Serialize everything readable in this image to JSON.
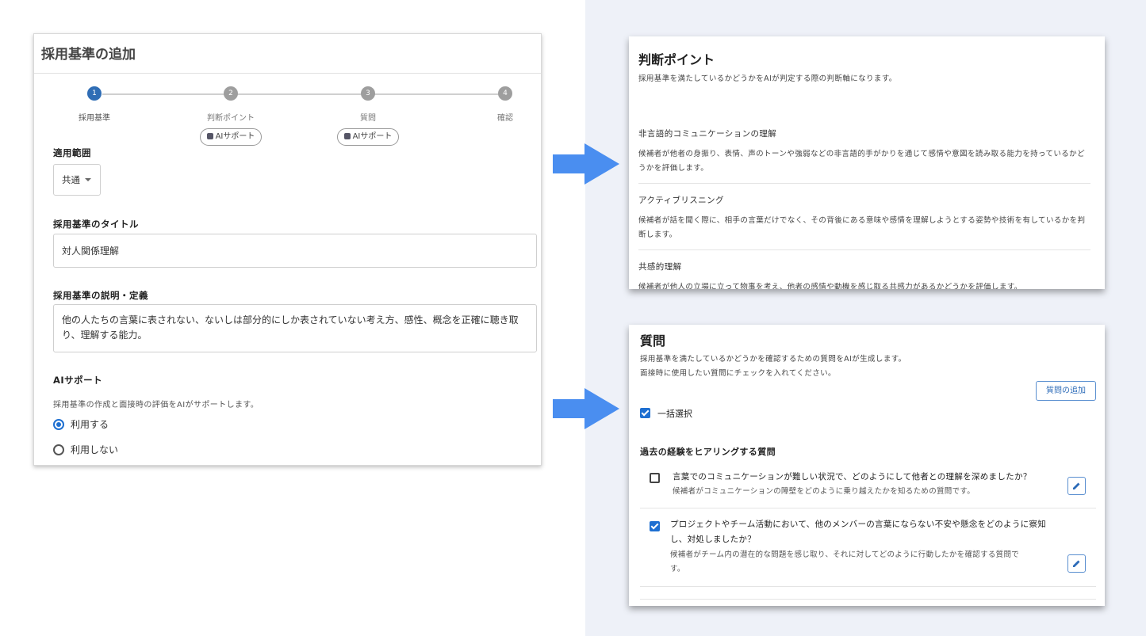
{
  "left_card": {
    "title": "採用基準の追加",
    "steps": [
      {
        "num": "1",
        "label": "採用基準"
      },
      {
        "num": "2",
        "label": "判断ポイント"
      },
      {
        "num": "3",
        "label": "質問"
      },
      {
        "num": "4",
        "label": "確認"
      }
    ],
    "ai_chip_label": "AIサポート",
    "scope": {
      "label": "適用範囲",
      "value": "共通"
    },
    "title_field": {
      "label": "採用基準のタイトル",
      "value": "対人関係理解"
    },
    "description_field": {
      "label": "採用基準の説明・定義",
      "value": "他の人たちの言葉に表されない、ないしは部分的にしか表されていない考え方、感性、概念を正確に聴き取り、理解する能力。"
    },
    "ai_support": {
      "label": "AIサポート",
      "description": "採用基準の作成と面接時の評価をAIがサポートします。",
      "options": [
        "利用する",
        "利用しない"
      ],
      "selected": "利用する"
    }
  },
  "judgment_card": {
    "title": "判断ポイント",
    "subtitle": "採用基準を満たしているかどうかをAIが判定する際の判断軸になります。",
    "items": [
      {
        "title": "非言語的コミュニケーションの理解",
        "description": "候補者が他者の身振り、表情、声のトーンや強弱などの非言語的手がかりを通じて感情や意図を読み取る能力を持っているかどうかを評価します。"
      },
      {
        "title": "アクティブリスニング",
        "description": "候補者が話を聞く際に、相手の言葉だけでなく、その背後にある意味や感情を理解しようとする姿勢や技術を有しているかを判断します。"
      },
      {
        "title": "共感的理解",
        "description": "候補者が他人の立場に立って物事を考え、他者の感情や動機を感じ取る共感力があるかどうかを評価します。"
      }
    ]
  },
  "questions_card": {
    "title": "質問",
    "subtitle_1": "採用基準を満たしているかどうかを確認するための質問をAIが生成します。",
    "subtitle_2": "面接時に使用したい質問にチェックを入れてください。",
    "add_button": "質問の追加",
    "select_all": "一括選択",
    "section_title": "過去の経験をヒアリングする質問",
    "questions": [
      {
        "checked": false,
        "text": "言葉でのコミュニケーションが難しい状況で、どのようにして他者との理解を深めましたか？",
        "note": "候補者がコミュニケーションの障壁をどのように乗り越えたかを知るための質問です。"
      },
      {
        "checked": true,
        "text_line1": "プロジェクトやチーム活動において、他のメンバーの言葉にならない不安や懸念をどのように察知",
        "text_line2": "し、対処しましたか？",
        "note_line1": "候補者がチーム内の潜在的な問題を感じ取り、それに対してどのように行動したかを確認する質問で",
        "note_line2": "す。"
      }
    ]
  },
  "colors": {
    "accent": "#2f6db5",
    "arrow": "#4a8ef0",
    "right_bg": "#eef1f8"
  }
}
